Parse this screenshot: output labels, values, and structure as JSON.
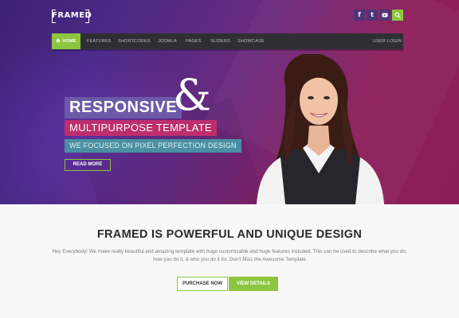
{
  "brand": {
    "logo_text": "FRAMED"
  },
  "social": [
    {
      "name": "facebook-icon",
      "glyph": "f"
    },
    {
      "name": "twitter-icon",
      "glyph": "t"
    },
    {
      "name": "youtube-icon",
      "glyph": "▶"
    },
    {
      "name": "search-icon",
      "glyph": ""
    }
  ],
  "nav": {
    "home": "HOME",
    "items": [
      "FEATURES",
      "SHORTCODES",
      "JOOMLA",
      "PAGES",
      "SLIDERS",
      "SHOWCASE"
    ],
    "user_login": "USER LOGIN"
  },
  "hero": {
    "headline": "RESPONSIVE",
    "ampersand": "&",
    "subheadline": "MULTIPURPOSE TEMPLATE",
    "tagline": "WE FOCUSED ON PIXEL PERFECTION DESIGN",
    "read_more": "READ MORE"
  },
  "content": {
    "title": "FRAMED IS POWERFUL AND UNIQUE DESIGN",
    "description": "Hey Everybody! We make really beautiful and amazing template with huge customizable and huge features included. This can be used to describe what you do, how you do it, & who you do it for. Don't Miss the Awesome Template",
    "purchase_button": "PURCHASE NOW",
    "view_button": "VIEW DETAILS"
  },
  "colors": {
    "accent": "#8cc63f",
    "nav_bg": "#2f2f33",
    "headline_bg": "#6c5aa8",
    "sub_bg": "#bd2e6b",
    "tag_bg": "#4a8fa2"
  }
}
